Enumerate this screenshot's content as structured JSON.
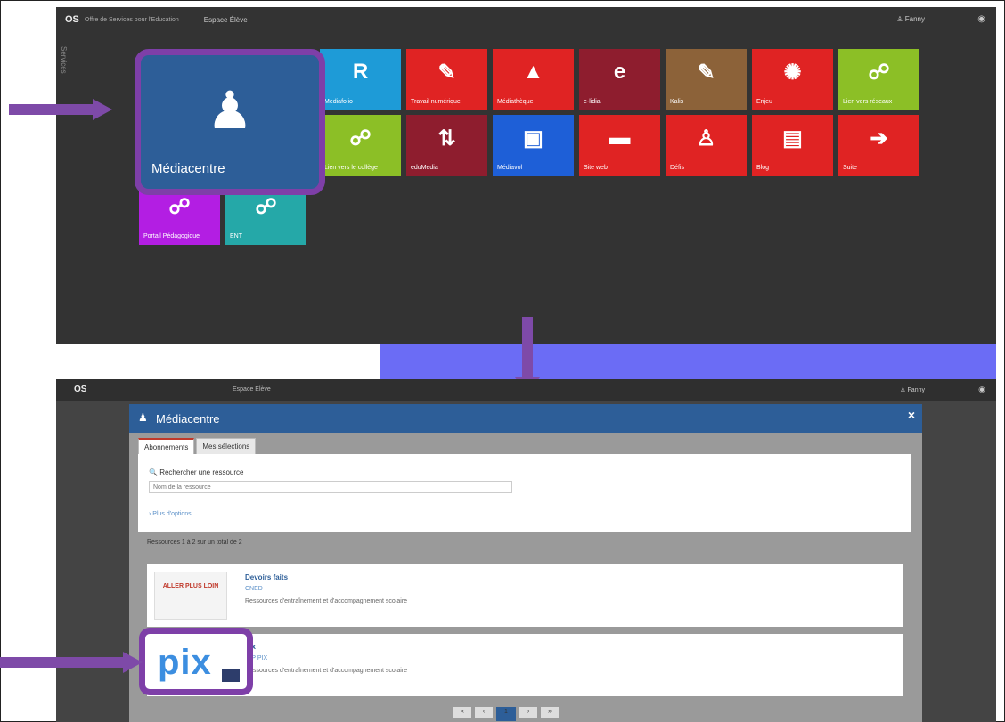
{
  "top_screen": {
    "logo": "OS",
    "logo_subtitle": "Offre de Services pour l'Education",
    "space_label": "Espace Élève",
    "user": "Fanny",
    "side_label": "Services",
    "featured_tile": {
      "label": "Médiacentre",
      "icon": "reader-icon",
      "color": "#2d5e98"
    },
    "tiles": [
      {
        "label": "Mediafolio",
        "icon": "qr-icon",
        "color": "#1e9bd7"
      },
      {
        "label": "Travail numérique",
        "icon": "board-icon",
        "color": "#e02323"
      },
      {
        "label": "Médiathèque",
        "icon": "hat-icon",
        "color": "#e02323"
      },
      {
        "label": "e-lidia",
        "icon": "e-icon",
        "color": "#8e1d2e"
      },
      {
        "label": "Kalis",
        "icon": "pencil-icon",
        "color": "#8c6239"
      },
      {
        "label": "Enjeu",
        "icon": "star-icon",
        "color": "#e02323"
      },
      {
        "label": "Lien vers réseaux",
        "icon": "link-icon",
        "color": "#8cbf26"
      },
      {
        "label": "Lien vers le collège",
        "icon": "link-icon",
        "color": "#8cbf26"
      },
      {
        "label": "eduMedia",
        "icon": "arrows-icon",
        "color": "#8e1d2e"
      },
      {
        "label": "Médiavol",
        "icon": "film-icon",
        "color": "#1e5fd7"
      },
      {
        "label": "Site web",
        "icon": "card-icon",
        "color": "#e02323"
      },
      {
        "label": "Défis",
        "icon": "people-icon",
        "color": "#e02323"
      },
      {
        "label": "Blog",
        "icon": "news-icon",
        "color": "#e02323"
      },
      {
        "label": "Suite",
        "icon": "arrow-right-icon",
        "color": "#e02323"
      },
      {
        "label": "Portail Pédagogique",
        "icon": "link-icon",
        "color": "#b31ee3"
      },
      {
        "label": "ENT",
        "icon": "link-icon",
        "color": "#25a8a8"
      }
    ]
  },
  "bottom_screen": {
    "logo": "OS",
    "space_label": "Espace Élève",
    "user": "Fanny",
    "modal": {
      "title": "Médiacentre",
      "close": "×",
      "tabs": [
        "Abonnements",
        "Mes sélections"
      ],
      "search_label": "Rechercher une ressource",
      "search_placeholder": "Nom de la ressource",
      "more_filters": "› Plus d'options",
      "results_count": "Ressources 1 à 2 sur un total de 2",
      "results": [
        {
          "title": "Devoirs faits",
          "publisher": "CNED",
          "description": "Ressources d'entraînement et d'accompagnement scolaire",
          "thumb": "ALLER PLUS LOIN"
        },
        {
          "title": "Pix",
          "publisher": "GIP PIX",
          "description": "Ressources d'entraînement et d'accompagnement scolaire",
          "thumb": "pix"
        }
      ],
      "pager": [
        "«",
        "‹",
        "1",
        "›",
        "»"
      ]
    }
  },
  "colors": {
    "arrow": "#7e4aa8",
    "band": "#6b6cf5"
  }
}
